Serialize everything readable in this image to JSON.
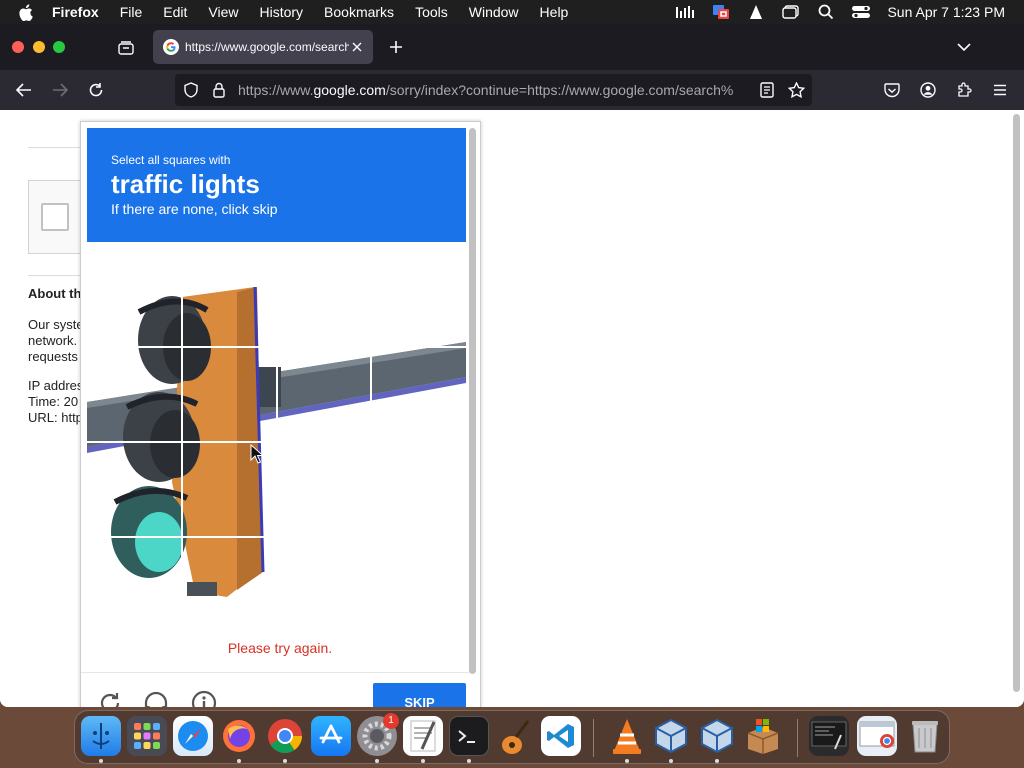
{
  "menubar": {
    "app_name": "Firefox",
    "items": [
      "File",
      "Edit",
      "View",
      "History",
      "Bookmarks",
      "Tools",
      "Window",
      "Help"
    ],
    "clock": "Sun Apr 7  1:23 PM"
  },
  "browser": {
    "tab_title": "https://www.google.com/search",
    "url_prefix": "https://www.",
    "url_domain": "google.com",
    "url_rest": "/sorry/index?continue=https://www.google.com/search%"
  },
  "page": {
    "about_heading": "About th",
    "body_lines": [
      "Our syste",
      "network.",
      "requests"
    ],
    "ip_line": "IP addres",
    "time_line": "Time: 20",
    "url_line": "URL: http"
  },
  "captcha": {
    "instruction": "Select all squares with",
    "target": "traffic lights",
    "hint": "If there are none, click skip",
    "error": "Please try again.",
    "skip_label": "SKIP",
    "grid_cols": 4,
    "grid_rows": 4
  },
  "dock": {
    "settings_badge": "1"
  },
  "colors": {
    "captcha_blue": "#1a73e8",
    "error_red": "#d93025",
    "browser_dark": "#1c1b22"
  }
}
